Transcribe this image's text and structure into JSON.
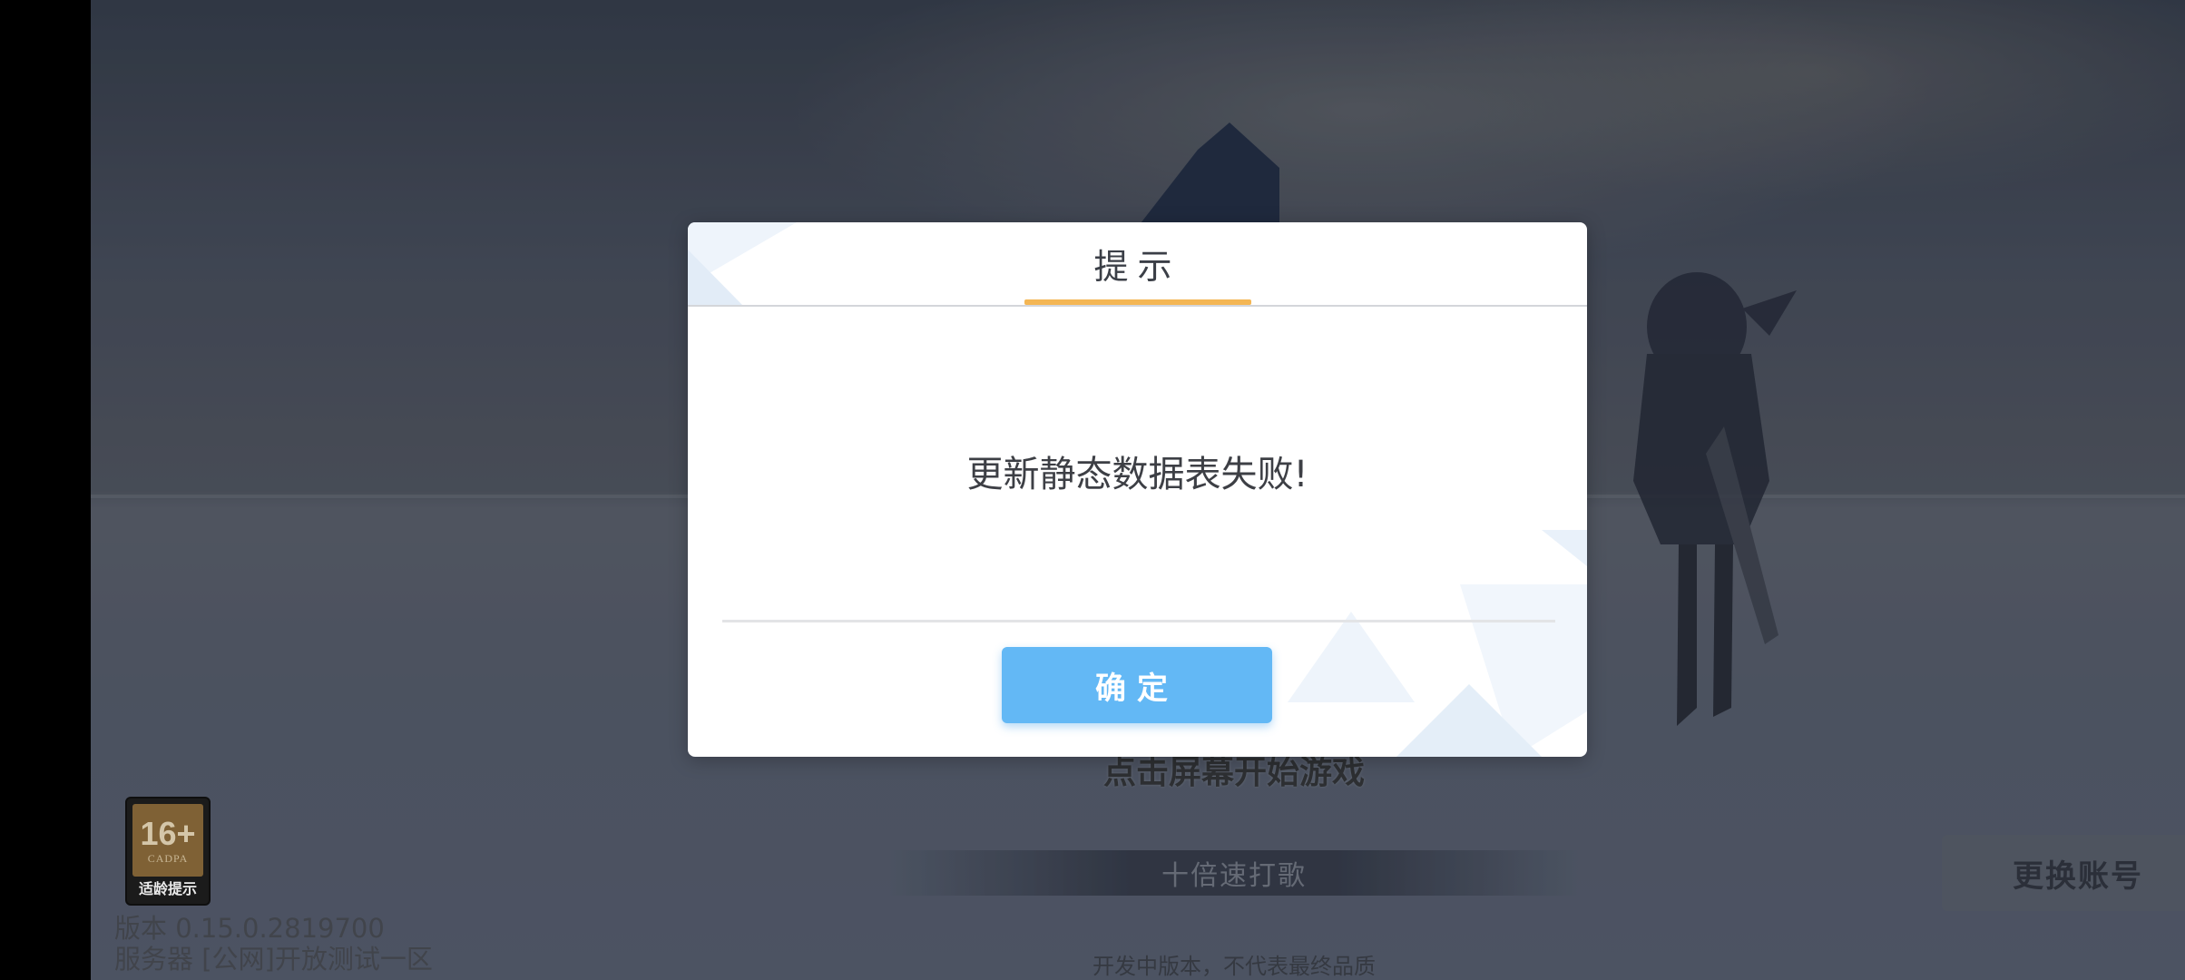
{
  "scene": {
    "start_prompt": "点击屏幕开始游戏",
    "speed_label": "十倍速打歌",
    "dev_note": "开发中版本，不代表最终品质",
    "switch_account_label": "更换账号"
  },
  "age_rating": {
    "number": "16+",
    "org": "CADPA",
    "tip": "适龄提示"
  },
  "version_info": {
    "version": "版本 0.15.0.2819700",
    "server": "服务器 [公网]开放测试一区"
  },
  "dialog": {
    "title": "提示",
    "message": "更新静态数据表失败!",
    "confirm_label": "确定"
  },
  "colors": {
    "accent_underline": "#f4b654",
    "confirm_button": "#63b8f5"
  }
}
